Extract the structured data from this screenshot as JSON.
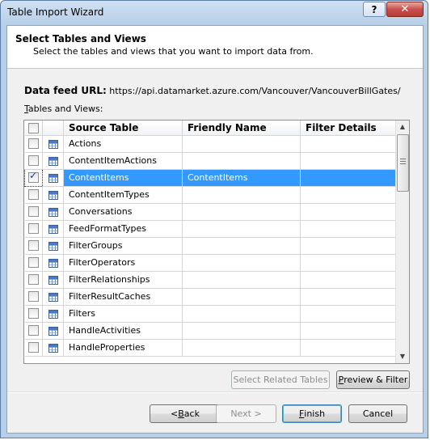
{
  "window": {
    "title": "Table Import Wizard",
    "help_label": "?",
    "close_label": "✕"
  },
  "header": {
    "title": "Select Tables and Views",
    "subtitle": "Select the tables and views that you want to import data from."
  },
  "feed": {
    "label": "Data feed URL:",
    "url": "https://api.datamarket.azure.com/Vancouver/VancouverBillGates/"
  },
  "tables_label": {
    "first": "T",
    "rest": "ables and Views:"
  },
  "grid": {
    "columns": [
      "Source Table",
      "Friendly Name",
      "Filter Details"
    ],
    "rows": [
      {
        "source": "Actions",
        "friendly": "",
        "filter": "",
        "checked": false,
        "selected": false
      },
      {
        "source": "ContentItemActions",
        "friendly": "",
        "filter": "",
        "checked": false,
        "selected": false
      },
      {
        "source": "ContentItems",
        "friendly": "ContentItems",
        "filter": "",
        "checked": true,
        "selected": true
      },
      {
        "source": "ContentItemTypes",
        "friendly": "",
        "filter": "",
        "checked": false,
        "selected": false
      },
      {
        "source": "Conversations",
        "friendly": "",
        "filter": "",
        "checked": false,
        "selected": false
      },
      {
        "source": "FeedFormatTypes",
        "friendly": "",
        "filter": "",
        "checked": false,
        "selected": false
      },
      {
        "source": "FilterGroups",
        "friendly": "",
        "filter": "",
        "checked": false,
        "selected": false
      },
      {
        "source": "FilterOperators",
        "friendly": "",
        "filter": "",
        "checked": false,
        "selected": false
      },
      {
        "source": "FilterRelationships",
        "friendly": "",
        "filter": "",
        "checked": false,
        "selected": false
      },
      {
        "source": "FilterResultCaches",
        "friendly": "",
        "filter": "",
        "checked": false,
        "selected": false
      },
      {
        "source": "Filters",
        "friendly": "",
        "filter": "",
        "checked": false,
        "selected": false
      },
      {
        "source": "HandleActivities",
        "friendly": "",
        "filter": "",
        "checked": false,
        "selected": false
      },
      {
        "source": "HandleProperties",
        "friendly": "",
        "filter": "",
        "checked": false,
        "selected": false
      }
    ]
  },
  "buttons": {
    "select_related": "Select Related Tables",
    "preview_first": "P",
    "preview_rest": "review & Filter",
    "back_prefix": "< ",
    "back_first": "B",
    "back_rest": "ack",
    "next": "Next >",
    "finish_first": "F",
    "finish_rest": "inish",
    "cancel": "Cancel"
  }
}
